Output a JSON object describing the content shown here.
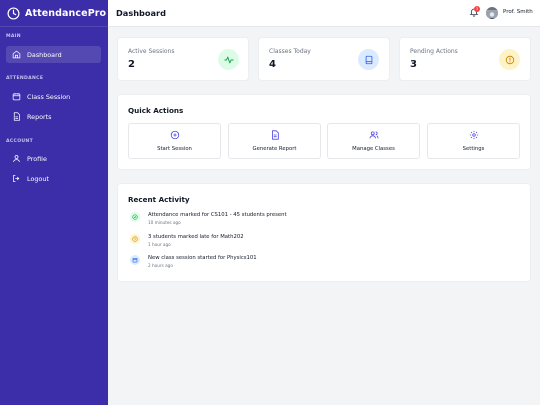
{
  "app": {
    "name": "AttendancePro"
  },
  "sidebar": {
    "sections": [
      {
        "label": "MAIN"
      },
      {
        "label": "ATTENDANCE"
      },
      {
        "label": "ACCOUNT"
      }
    ],
    "items": [
      {
        "label": "Dashboard",
        "icon": "home-icon",
        "active": true
      },
      {
        "label": "Class Session",
        "icon": "calendar-icon",
        "active": false
      },
      {
        "label": "Reports",
        "icon": "document-icon",
        "active": false
      },
      {
        "label": "Profile",
        "icon": "user-icon",
        "active": false
      },
      {
        "label": "Logout",
        "icon": "logout-icon",
        "active": false
      }
    ]
  },
  "header": {
    "title": "Dashboard",
    "notification_count": "3",
    "user_name": "Prof. Smith"
  },
  "stats": [
    {
      "label": "Active Sessions",
      "value": "2",
      "icon": "activity-icon",
      "icon_bg": "#dcfce7",
      "icon_color": "#16a34a"
    },
    {
      "label": "Classes Today",
      "value": "4",
      "icon": "book-icon",
      "icon_bg": "#dbeafe",
      "icon_color": "#2563eb"
    },
    {
      "label": "Pending Actions",
      "value": "3",
      "icon": "alert-icon",
      "icon_bg": "#fef3c7",
      "icon_color": "#ca8a04"
    }
  ],
  "quick_actions": {
    "title": "Quick Actions",
    "buttons": [
      {
        "label": "Start Session",
        "icon": "plus-circle-icon"
      },
      {
        "label": "Generate Report",
        "icon": "file-text-icon"
      },
      {
        "label": "Manage Classes",
        "icon": "users-icon"
      },
      {
        "label": "Settings",
        "icon": "gear-icon"
      }
    ]
  },
  "recent_activity": {
    "title": "Recent Activity",
    "items": [
      {
        "text": "Attendance marked for CS101 - 45 students present",
        "time": "10 minutes ago",
        "icon": "check-circle-icon",
        "icon_bg": "#dcfce7",
        "icon_color": "#16a34a"
      },
      {
        "text": "3 students marked late for Math202",
        "time": "1 hour ago",
        "icon": "clock-icon",
        "icon_bg": "#fef3c7",
        "icon_color": "#ca8a04"
      },
      {
        "text": "New class session started for Physics101",
        "time": "2 hours ago",
        "icon": "calendar-icon",
        "icon_bg": "#dbeafe",
        "icon_color": "#2563eb"
      }
    ]
  },
  "colors": {
    "sidebar": "#3b2ea8",
    "accent": "#4f46e5",
    "background": "#f3f4f6"
  }
}
